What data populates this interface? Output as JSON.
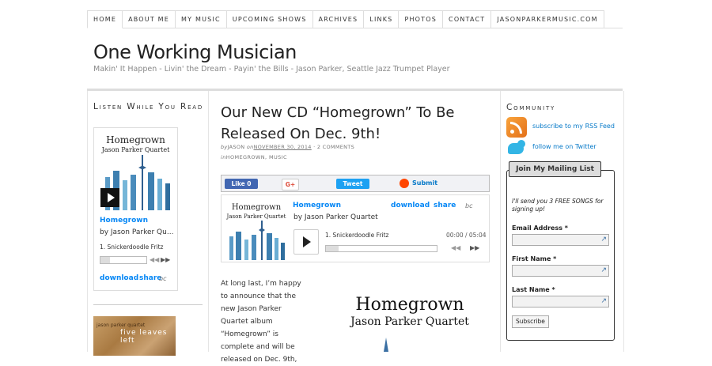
{
  "nav": {
    "items": [
      "HOME",
      "ABOUT ME",
      "MY MUSIC",
      "UPCOMING SHOWS",
      "ARCHIVES",
      "LINKS",
      "PHOTOS",
      "CONTACT",
      "JASONPARKERMUSIC.COM"
    ]
  },
  "header": {
    "title": "One Working Musician",
    "tagline": "Makin' It Happen - Livin' the Dream - Payin' the Bills - Jason Parker, Seattle Jazz Trumpet Player"
  },
  "sidebar_left": {
    "title": "Listen While You Read",
    "player": {
      "art_title": "Homegrown",
      "art_subtitle": "Jason Parker Quartet",
      "album": "Homegrown",
      "artist": "by Jason Parker Qu...",
      "track": "1.  Snickerdoodle Fritz",
      "download": "download",
      "share": "share",
      "bc": "bc"
    },
    "second_album_label": "jason parker quartet",
    "second_album_title": "five leaves left"
  },
  "post": {
    "title": "Our New CD “Homegrown” To Be Released On Dec. 9th!",
    "meta_by": "by",
    "meta_author": "JASON",
    "meta_on": "on",
    "meta_date": "NOVEMBER 30, 2014",
    "meta_comments": "· 2 COMMENTS",
    "cats_in": "in",
    "cats": "HOMEGROWN, MUSIC",
    "share": {
      "like": "Like 0",
      "gplus": "G+",
      "tweet": "Tweet",
      "submit": "Submit"
    },
    "player": {
      "art_title": "Homegrown",
      "art_subtitle": "Jason Parker Quartet",
      "album": "Homegrown",
      "artist": "by Jason Parker Quartet",
      "download": "download",
      "share": "share",
      "bc": "bc",
      "track": "1.  Snickerdoodle Fritz",
      "time": "00:00 / 05:04"
    },
    "body": "At long last, I’m happy to announce that the new Jason Parker Quartet album “Homegrown” is complete and will be released on Dec. 9th,",
    "art_title": "Homegrown",
    "art_subtitle": "Jason Parker Quartet"
  },
  "sidebar_right": {
    "title": "Community",
    "rss": "subscribe to my RSS Feed",
    "twitter": "follow me on Twitter",
    "mailing": {
      "header": "Join My Mailing List",
      "intro": "I'll send you 3 FREE SONGS for signing up!",
      "email_label": "Email Address *",
      "first_label": "First Name *",
      "last_label": "Last Name *",
      "submit": "Subscribe"
    }
  },
  "colors": {
    "link": "#0679c8",
    "bandcamp": "#0687f5",
    "facebook": "#4267b2",
    "twitter": "#1da1f2"
  }
}
